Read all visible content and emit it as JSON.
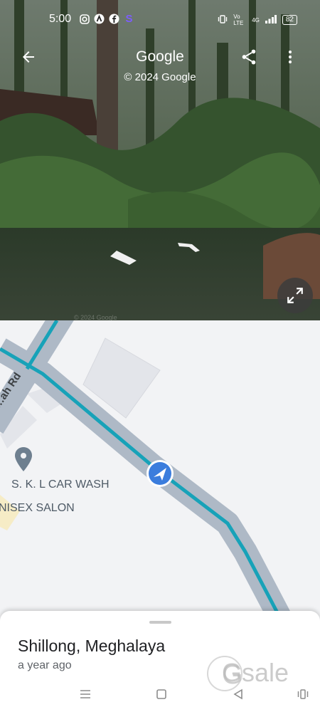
{
  "status_bar": {
    "time": "5:00",
    "app_icons": [
      "instagram-icon",
      "a-icon",
      "facebook-icon",
      "s-icon"
    ],
    "network": "Vo LTE",
    "signal": "4G",
    "battery": "82"
  },
  "street_view": {
    "title": "Google",
    "copyright": "© 2024 Google",
    "watermark_text": "© 2024 Google"
  },
  "map": {
    "road_label": "…ah Rd",
    "places": [
      {
        "name": "S. K. L CAR WASH"
      },
      {
        "name": "NISEX SALON"
      }
    ]
  },
  "place_sheet": {
    "name": "Shillong, Meghalaya",
    "age": "a year ago"
  },
  "watermark": {
    "brand": "Gsale"
  },
  "colors": {
    "route": "#17a2b8",
    "location_dot": "#3b7ddd",
    "map_bg": "#f2f3f5"
  }
}
